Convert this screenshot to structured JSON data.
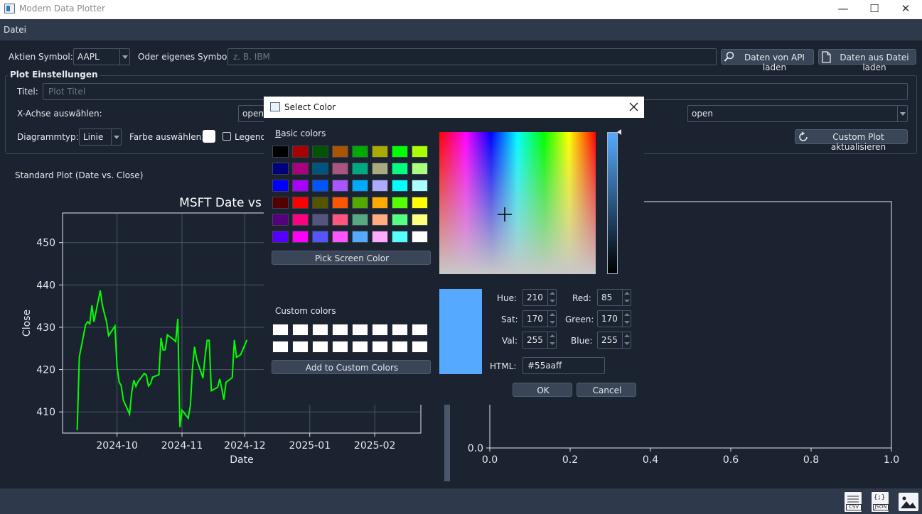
{
  "window": {
    "title": "Modern Data Plotter",
    "min_glyph": "—",
    "max_glyph": "☐",
    "close_glyph": "✕"
  },
  "menubar": {
    "file": "Datei"
  },
  "toolbar": {
    "stock_symbol_label": "Aktien Symbol:",
    "stock_symbol_value": "AAPL",
    "custom_symbol_label": "Oder eigenes Symbol:",
    "custom_symbol_placeholder": "z. B. IBM",
    "load_api_button": "Daten von API laden",
    "load_file_button": "Daten aus Datei laden"
  },
  "plot_settings": {
    "group_title": "Plot Einstellungen",
    "title_label": "Titel:",
    "title_placeholder": "Plot Titel",
    "x_axis_label": "X-Achse auswählen:",
    "x_axis_value": "open",
    "y_axis_value": "open",
    "chart_type_label": "Diagrammtyp:",
    "chart_type_value": "Linie",
    "color_label": "Farbe auswählen:",
    "legend_label": "Legende",
    "update_button": "Custom Plot aktualisieren"
  },
  "standard_plot": {
    "caption": "Standard Plot (Date vs. Close)",
    "chart_title": "MSFT  Date vs"
  },
  "chart_data": [
    {
      "type": "line",
      "title": "MSFT  Date vs",
      "xlabel": "Date",
      "ylabel": "Close",
      "x_ticks": [
        "2024-10",
        "2024-11",
        "2024-12",
        "2025-01",
        "2025-02"
      ],
      "y_ticks": [
        410,
        420,
        430,
        440,
        450
      ],
      "ylim": [
        405,
        457
      ],
      "grid": true,
      "series": [
        {
          "color": "#00ff00",
          "x": [
            "2024-09-12",
            "2024-09-13",
            "2024-09-16",
            "2024-09-17",
            "2024-09-18",
            "2024-09-19",
            "2024-09-20",
            "2024-09-23",
            "2024-09-24",
            "2024-09-25",
            "2024-09-26",
            "2024-09-27",
            "2024-09-30",
            "2024-10-01",
            "2024-10-02",
            "2024-10-03",
            "2024-10-04",
            "2024-10-07",
            "2024-10-08",
            "2024-10-09",
            "2024-10-10",
            "2024-10-11",
            "2024-10-14",
            "2024-10-15",
            "2024-10-16",
            "2024-10-17",
            "2024-10-18",
            "2024-10-21",
            "2024-10-22",
            "2024-10-23",
            "2024-10-24",
            "2024-10-25",
            "2024-10-28",
            "2024-10-29",
            "2024-10-30",
            "2024-10-31",
            "2024-11-01",
            "2024-11-04",
            "2024-11-05",
            "2024-11-06",
            "2024-11-07",
            "2024-11-08",
            "2024-11-11",
            "2024-11-12",
            "2024-11-13",
            "2024-11-14",
            "2024-11-15",
            "2024-11-18",
            "2024-11-19",
            "2024-11-20",
            "2024-11-21",
            "2024-11-22",
            "2024-11-25",
            "2024-11-26",
            "2024-11-27",
            "2024-11-29",
            "2024-12-02"
          ],
          "y": [
            405.7,
            423.0,
            430.6,
            431.3,
            430.8,
            435.2,
            431.3,
            438.7,
            435.2,
            433.2,
            431.3,
            428.0,
            430.3,
            420.7,
            417.1,
            416.2,
            412.8,
            409.5,
            414.7,
            417.5,
            416.0,
            417.1,
            419.1,
            418.7,
            416.1,
            416.7,
            418.2,
            418.8,
            427.5,
            424.6,
            424.7,
            428.2,
            427.1,
            426.6,
            432.0,
            406.4,
            410.4,
            408.5,
            411.5,
            420.2,
            425.4,
            422.5,
            418.0,
            423.0,
            426.9,
            426.9,
            415.0,
            415.8,
            417.8,
            415.5,
            412.9,
            417.0,
            418.1,
            427.0,
            422.9,
            423.5,
            427.0
          ]
        }
      ]
    },
    {
      "type": "line",
      "x_ticks": [
        "0.0",
        "0.2",
        "0.4",
        "0.6",
        "0.8",
        "1.0"
      ],
      "y_ticks": [
        "0.0"
      ],
      "xlim": [
        0,
        1
      ],
      "ylim": [
        0,
        1
      ],
      "grid": false,
      "series": []
    }
  ],
  "color_dialog": {
    "title": "Select Color",
    "basic_colors_label": "Basic colors",
    "basic_colors": [
      "#000000",
      "#aa0000",
      "#005500",
      "#aa5500",
      "#00aa00",
      "#aaaa00",
      "#00ff00",
      "#aaff00",
      "#00007f",
      "#aa007f",
      "#00557f",
      "#aa557f",
      "#00aa7f",
      "#aaaa7f",
      "#00ff7f",
      "#aaff7f",
      "#0000ff",
      "#aa00ff",
      "#0055ff",
      "#aa55ff",
      "#00aaff",
      "#aaaaff",
      "#00ffff",
      "#aaffff",
      "#550000",
      "#ff0000",
      "#555500",
      "#ff5500",
      "#55aa00",
      "#ffaa00",
      "#55ff00",
      "#ffff00",
      "#55007f",
      "#ff007f",
      "#55557f",
      "#ff557f",
      "#55aa7f",
      "#ffaa7f",
      "#55ff7f",
      "#ffff7f",
      "#5500ff",
      "#ff00ff",
      "#5555ff",
      "#ff55ff",
      "#55aaff",
      "#ffaaff",
      "#55ffff",
      "#ffffff"
    ],
    "pick_screen_button": "Pick Screen Color",
    "custom_colors_label": "Custom colors",
    "add_custom_button": "Add to Custom Colors",
    "current_color": "#55aaff",
    "fields": {
      "hue_label": "Hue:",
      "hue": "210",
      "sat_label": "Sat:",
      "sat": "170",
      "val_label": "Val:",
      "val": "255",
      "red_label": "Red:",
      "red": "85",
      "green_label": "Green:",
      "green": "170",
      "blue_label": "Blue:",
      "blue": "255",
      "html_label": "HTML:",
      "html": "#55aaff"
    },
    "ok_button": "OK",
    "cancel_button": "Cancel"
  },
  "bottom_icons": {
    "csv": "CSV",
    "json": "JSON",
    "image": "image-export-icon"
  }
}
